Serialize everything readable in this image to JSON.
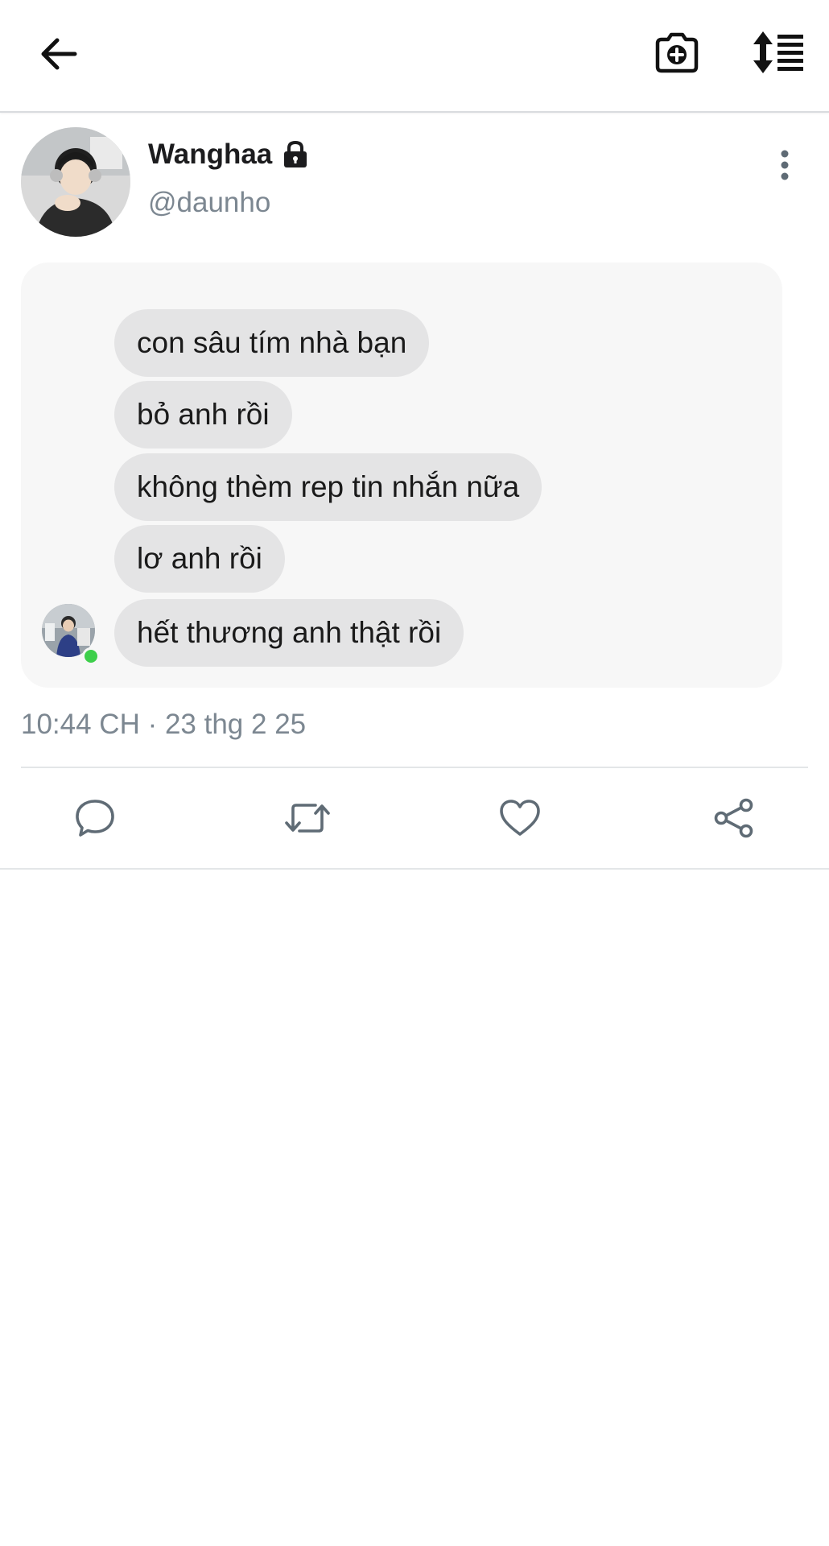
{
  "toolbar": {
    "back_icon": "arrow-left-icon",
    "camera_icon": "camera-plus-icon",
    "sort_icon": "sort-list-icon"
  },
  "author": {
    "display_name": "Wanghaa",
    "badge_icon": "lock-icon",
    "handle": "@daunho"
  },
  "media": {
    "messages": [
      "con sâu tím nhà bạn",
      "bỏ anh rồi",
      "không thèm rep tin nhắn nữa",
      "lơ anh rồi",
      "hết thương anh thật rồi"
    ],
    "presence_color": "#3ecf4b"
  },
  "post": {
    "timestamp": "10:44 CH · 23 thg 2 25"
  },
  "actions": {
    "reply_icon": "comment-icon",
    "retweet_icon": "retweet-icon",
    "like_icon": "heart-icon",
    "share_icon": "share-icon"
  },
  "colors": {
    "muted_text": "#7c8791",
    "bubble_bg": "#e4e4e5",
    "card_bg": "#f7f7f7"
  }
}
